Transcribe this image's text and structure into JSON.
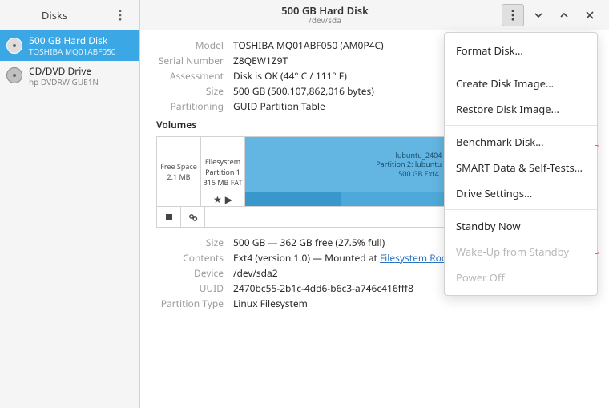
{
  "sidebar": {
    "title": "Disks",
    "items": [
      {
        "name": "500 GB Hard Disk",
        "sub": "TOSHIBA MQ01ABF050",
        "icon": "hdd"
      },
      {
        "name": "CD/DVD Drive",
        "sub": "hp     DVDRW GUE1N",
        "icon": "optical"
      }
    ]
  },
  "header": {
    "title": "500 GB Hard Disk",
    "subtitle": "/dev/sda"
  },
  "info": {
    "model_label": "Model",
    "model": "TOSHIBA MQ01ABF050 (AM0P4C)",
    "serial_label": "Serial Number",
    "serial": "Z8QEW1Z9T",
    "assessment_label": "Assessment",
    "assessment": "Disk is OK (44° C / 111° F)",
    "size_label": "Size",
    "size": "500 GB (500,107,862,016 bytes)",
    "partitioning_label": "Partitioning",
    "partitioning": "GUID Partition Table"
  },
  "volumes": {
    "heading": "Volumes",
    "free": {
      "label": "Free Space",
      "size": "2.1 MB"
    },
    "p1": {
      "label": "Filesystem",
      "sub1": "Partition 1",
      "sub2": "315 MB FAT"
    },
    "p2": {
      "label": "lubuntu_2404",
      "sub1": "Partition 2: lubuntu_2404",
      "sub2": "500 GB Ext4",
      "usage_percent": 27.5
    }
  },
  "volinfo": {
    "size_label": "Size",
    "size": "500 GB — 362 GB free (27.5% full)",
    "contents_label": "Contents",
    "contents_prefix": "Ext4 (version 1.0) — Mounted at ",
    "contents_link": "Filesystem Root",
    "device_label": "Device",
    "device": "/dev/sda2",
    "uuid_label": "UUID",
    "uuid": "2470bc55-2b1c-4dd6-b6c3-a746c416fff8",
    "ptype_label": "Partition Type",
    "ptype": "Linux Filesystem"
  },
  "menu": {
    "items": [
      {
        "key": "format",
        "label": "Format Disk…",
        "disabled": false
      },
      {
        "key": "sep"
      },
      {
        "key": "createimg",
        "label": "Create Disk Image…",
        "disabled": false
      },
      {
        "key": "restoreimg",
        "label": "Restore Disk Image…",
        "disabled": false
      },
      {
        "key": "sep"
      },
      {
        "key": "benchmark",
        "label": "Benchmark Disk…",
        "disabled": false
      },
      {
        "key": "smart",
        "label": "SMART Data & Self-Tests…",
        "disabled": false
      },
      {
        "key": "settings",
        "label": "Drive Settings…",
        "disabled": false
      },
      {
        "key": "sep"
      },
      {
        "key": "standby",
        "label": "Standby Now",
        "disabled": false
      },
      {
        "key": "wakeup",
        "label": "Wake-Up from Standby",
        "disabled": true
      },
      {
        "key": "poweroff",
        "label": "Power Off",
        "disabled": true
      }
    ]
  }
}
